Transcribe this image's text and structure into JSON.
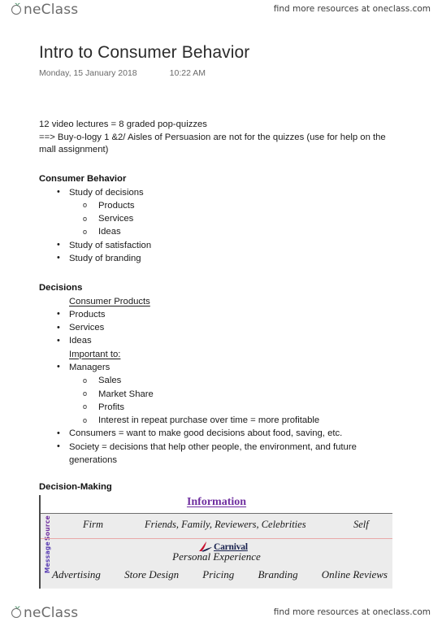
{
  "brand": {
    "logo_o": "O",
    "logo_rest": "neClass",
    "logo_leaf_icon": "leaf-icon",
    "tagline": "find more resources at oneclass.com"
  },
  "note": {
    "title": "Intro to Consumer Behavior",
    "date": "Monday, 15 January 2018",
    "time": "10:22 AM",
    "intro": {
      "line1": "12 video lectures = 8 graded pop-quizzes",
      "line2": "==> Buy-o-logy 1 &2/ Aisles of Persuasion are not for the quizzes (use for help on the mall assignment)"
    },
    "sections": [
      {
        "heading": "Consumer Behavior",
        "items": [
          {
            "text": "Study of decisions",
            "subitems": [
              "Products",
              "Services",
              "Ideas"
            ]
          },
          {
            "text": "Study of satisfaction",
            "subitems": []
          },
          {
            "text": "Study of branding",
            "subitems": []
          }
        ]
      },
      {
        "heading": "Decisions",
        "lead": "Consumer Products",
        "lead2": "Important to:",
        "items": [
          {
            "text": "Products"
          },
          {
            "text": "Services"
          },
          {
            "text": "Ideas"
          },
          {
            "text": "Managers",
            "subitems": [
              "Sales",
              "Market Share",
              "Profits",
              "Interest in repeat purchase over time = more profitable"
            ]
          },
          {
            "text": "Consumers = want to make good decisions about food, saving, etc."
          },
          {
            "text": "Society = decisions that help other people, the environment, and future generations"
          }
        ]
      },
      {
        "heading": "Decision-Making"
      }
    ]
  },
  "diagram": {
    "header": "Information",
    "row_labels": {
      "source": "Source",
      "message": "Message"
    },
    "source_row": {
      "firm": "Firm",
      "friends": "Friends, Family, Reviewers, Celebrities",
      "self": "Self"
    },
    "message_row": {
      "brand_logo": "Carnival",
      "brand_mark_icon": "carnival-swoosh-icon",
      "personal_experience": "Personal Experience",
      "channels": [
        "Advertising",
        "Store Design",
        "Pricing",
        "Branding",
        "Online Reviews"
      ]
    },
    "colors": {
      "header_purple": "#7030a0",
      "source_label": "#7030a0",
      "message_label": "#5b3fb5",
      "divider_pink": "#e8a8a8",
      "cell_bg": "#ececec"
    }
  }
}
